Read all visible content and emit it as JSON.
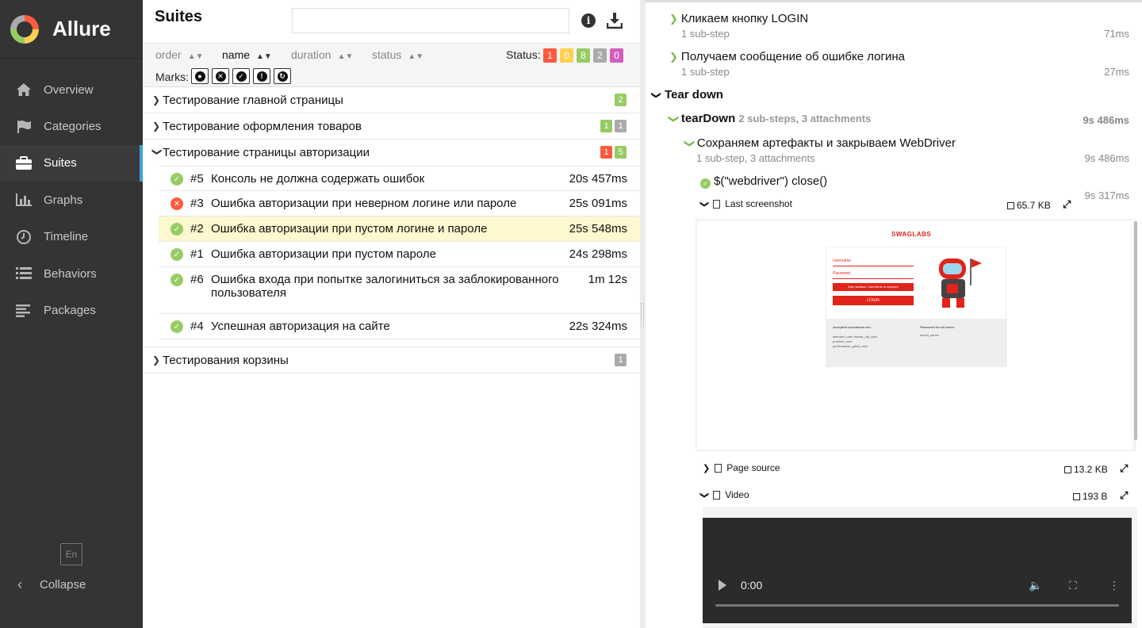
{
  "sidebar": {
    "brand": "Allure",
    "items": [
      {
        "label": "Overview",
        "icon": "home-icon"
      },
      {
        "label": "Categories",
        "icon": "flag-icon"
      },
      {
        "label": "Suites",
        "icon": "briefcase-icon"
      },
      {
        "label": "Graphs",
        "icon": "bar-chart-icon"
      },
      {
        "label": "Timeline",
        "icon": "clock-icon"
      },
      {
        "label": "Behaviors",
        "icon": "list-icon"
      },
      {
        "label": "Packages",
        "icon": "align-left-icon"
      }
    ],
    "lang": "En",
    "collapse": "Collapse"
  },
  "suites": {
    "title": "Suites",
    "search_placeholder": "",
    "sort": {
      "order": "order",
      "name": "name",
      "duration": "duration",
      "status": "status"
    },
    "status_label": "Status:",
    "status_counts": {
      "failed": "1",
      "broken": "0",
      "passed": "8",
      "skipped": "2",
      "unknown": "0"
    },
    "marks_label": "Marks:",
    "groups": [
      {
        "name": "Тестирование главной страницы",
        "counts": [
          "2"
        ]
      },
      {
        "name": "Тестирование оформления товаров",
        "counts": [
          "1",
          "1"
        ]
      },
      {
        "name": "Тестирование страницы авторизации",
        "counts": [
          "1",
          "5"
        ]
      },
      {
        "name": "Тестирования корзины",
        "counts": [
          "1"
        ]
      }
    ],
    "cases": [
      {
        "num": "#5",
        "name": "Консоль не должна содержать ошибок",
        "duration": "20s 457ms",
        "status": "passed"
      },
      {
        "num": "#3",
        "name": "Ошибка авторизации при неверном логине или пароле",
        "duration": "25s 091ms",
        "status": "failed"
      },
      {
        "num": "#2",
        "name": "Ошибка авторизации при пустом логине и пароле",
        "duration": "25s 548ms",
        "status": "passed"
      },
      {
        "num": "#1",
        "name": "Ошибка авторизации при пустом пароле",
        "duration": "24s 298ms",
        "status": "passed"
      },
      {
        "num": "#6",
        "name": "Ошибка входа при попытке залогиниться за заблокированного пользователя",
        "duration": "1m 12s",
        "status": "passed"
      },
      {
        "num": "#4",
        "name": "Успешная авторизация на сайте",
        "duration": "22s 324ms",
        "status": "passed"
      }
    ]
  },
  "detail": {
    "step1": {
      "name": "Кликаем кнопку LOGIN",
      "sub": "1 sub-step",
      "time": "71ms"
    },
    "step2": {
      "name": "Получаем сообщение об ошибке логина",
      "sub": "1 sub-step",
      "time": "27ms"
    },
    "teardown_title": "Tear down",
    "teardown": {
      "name": "tearDown",
      "meta": "2 sub-steps, 3 attachments",
      "time": "9s 486ms"
    },
    "step3": {
      "name": "Сохраняем артефакты и закрываем WebDriver",
      "sub": "1 sub-step, 3 attachments",
      "time": "9s 486ms"
    },
    "step4": {
      "name": "$(\"webdriver\") close()",
      "time": "9s 317ms"
    },
    "attachments": [
      {
        "name": "Last screenshot",
        "size": "65.7 KB"
      },
      {
        "name": "Page source",
        "size": "13.2 KB"
      },
      {
        "name": "Video",
        "size": "193 B"
      }
    ],
    "screenshot": {
      "logo": "SWAGLABS",
      "username_placeholder": "Username",
      "password_placeholder": "Password",
      "error": "Epic sadface: Username is required",
      "login": "LOGIN",
      "accepted_label": "Accepted usernames are:",
      "accepted": "standard_user locked_out_user problem_user performance_glitch_user",
      "password_label": "Password for all users:",
      "password": "secret_sauce"
    },
    "video_time": "0:00"
  }
}
